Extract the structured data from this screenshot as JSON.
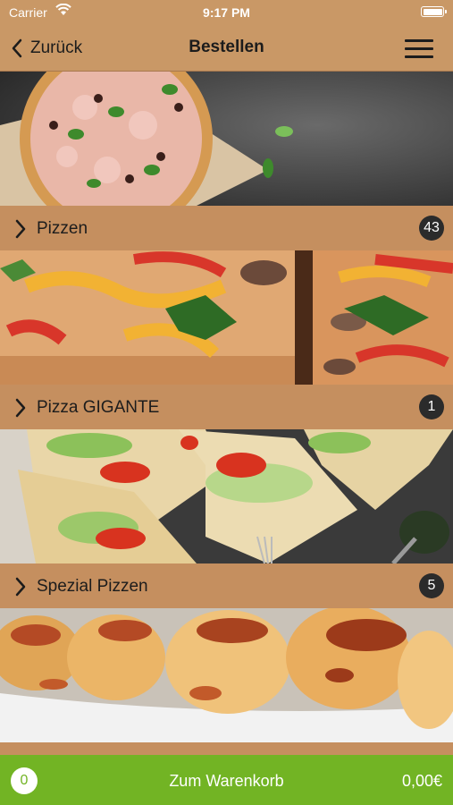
{
  "status_bar": {
    "carrier": "Carrier",
    "time": "9:17 PM"
  },
  "nav": {
    "back_label": "Zurück",
    "title": "Bestellen"
  },
  "categories": [
    {
      "label": "Pizzen",
      "count": "43"
    },
    {
      "label": "Pizza GIGANTE",
      "count": "1"
    },
    {
      "label": "Spezial Pizzen",
      "count": "5"
    }
  ],
  "cart": {
    "count": "0",
    "label": "Zum Warenkorb",
    "total": "0,00€"
  },
  "colors": {
    "bar": "#c99866",
    "row": "#c58f5f",
    "cart_bar": "#72b424",
    "badge": "#2b2b2b"
  }
}
